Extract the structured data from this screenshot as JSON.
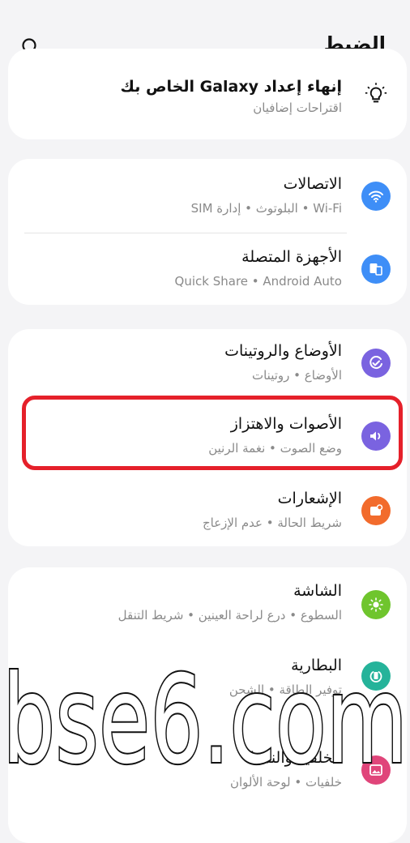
{
  "header": {
    "title": "الضبط",
    "search_icon": "search-icon"
  },
  "suggestion": {
    "title": "إنهاء إعداد Galaxy الخاص بك",
    "subtitle": "اقتراحات إضافيان",
    "icon": "lightbulb-icon"
  },
  "groups": [
    {
      "items": [
        {
          "title": "الاتصالات",
          "subtitle": "Wi-Fi • البلوتوث • إدارة SIM",
          "icon": "wifi-icon",
          "color": "#3e8ef7"
        },
        {
          "title": "الأجهزة المتصلة",
          "subtitle": "Quick Share • Android Auto",
          "icon": "devices-icon",
          "color": "#3e8ef7"
        }
      ]
    },
    {
      "items": [
        {
          "title": "الأوضاع والروتينات",
          "subtitle": "الأوضاع • روتينات",
          "icon": "modes-icon",
          "color": "#7a63e0"
        },
        {
          "title": "الأصوات والاهتزاز",
          "subtitle": "وضع الصوت • نغمة الرنين",
          "icon": "volume-icon",
          "color": "#7a63e0"
        },
        {
          "title": "الإشعارات",
          "subtitle": "شريط الحالة • عدم الإزعاج",
          "icon": "notifications-icon",
          "color": "#f26b2c"
        }
      ]
    },
    {
      "items": [
        {
          "title": "الشاشة",
          "subtitle": "السطوع • درع لراحة العينين • شريط التنقل",
          "icon": "display-icon",
          "color": "#6fc52d"
        },
        {
          "title": "البطارية",
          "subtitle": "توفير الطاقة • الشحن",
          "icon": "battery-icon",
          "color": "#25b39a"
        },
        {
          "title": "الخلفية والنمط",
          "subtitle": "خلفيات • لوحة الألوان",
          "icon": "wallpaper-icon",
          "color": "#e0457a"
        }
      ]
    }
  ],
  "watermark": {
    "text": "bse6.com"
  }
}
